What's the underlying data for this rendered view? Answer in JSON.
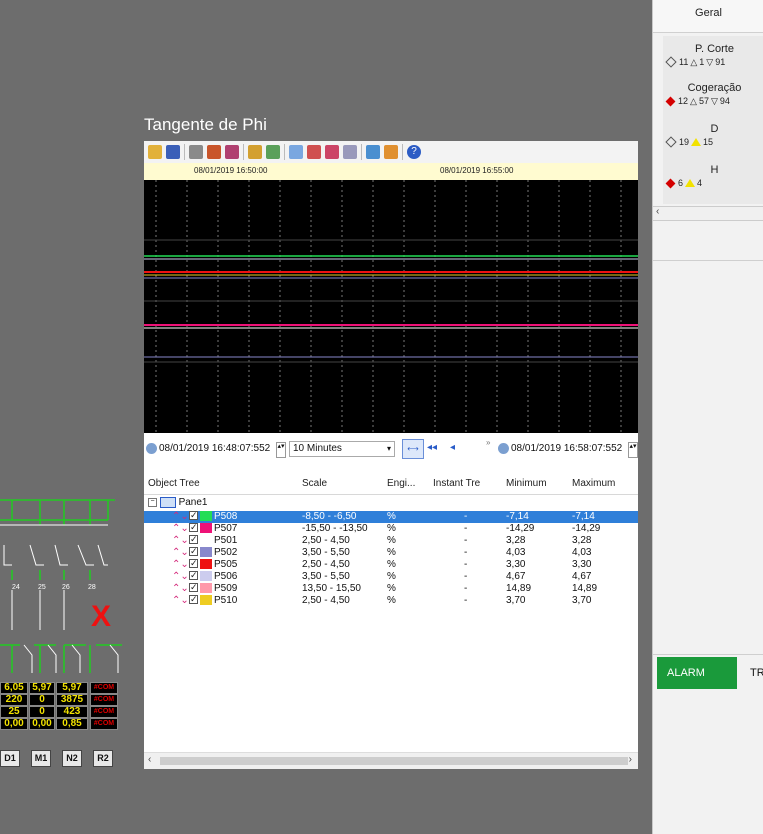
{
  "right_panel": {
    "tab_geral": "Geral",
    "zones": [
      {
        "name": "P. Corte",
        "c1": "11",
        "c2": "1",
        "c3": "91",
        "marker": "outline"
      },
      {
        "name": "Cogeração",
        "c1": "12",
        "c2": "57",
        "c3": "94",
        "marker": "red"
      },
      {
        "name": "D",
        "c1": "19",
        "c2": "15",
        "marker": "outline"
      },
      {
        "name": "H",
        "c1": "6",
        "c2": "4",
        "marker": "red"
      }
    ],
    "bottom_tabs": [
      "ALARM",
      "TR"
    ]
  },
  "window": {
    "title": "Tangente de Phi",
    "time_labels": [
      "08/01/2019 16:50:00",
      "08/01/2019 16:55:00"
    ],
    "start_time": "08/01/2019 16:48:07:552",
    "duration": "10 Minutes",
    "end_time": "08/01/2019 16:58:07:552",
    "columns": [
      "Object Tree",
      "Scale",
      "Engi...",
      "Instant Tre",
      "Minimum",
      "Maximum"
    ],
    "pane": "Pane1",
    "rows": [
      {
        "name": "P508",
        "scale": "-8,50 - -6,50",
        "eng": "%",
        "inst": "-",
        "min": "-7,14",
        "max": "-7,14",
        "color": "#22dd55",
        "selected": true
      },
      {
        "name": "P507",
        "scale": "-15,50 - -13,50",
        "eng": "%",
        "inst": "-",
        "min": "-14,29",
        "max": "-14,29",
        "color": "#ee1177"
      },
      {
        "name": "P501",
        "scale": "2,50 - 4,50",
        "eng": "%",
        "inst": "-",
        "min": "3,28",
        "max": "3,28",
        "color": "#ffffff"
      },
      {
        "name": "P502",
        "scale": "3,50 - 5,50",
        "eng": "%",
        "inst": "-",
        "min": "4,03",
        "max": "4,03",
        "color": "#8888cc"
      },
      {
        "name": "P505",
        "scale": "2,50 - 4,50",
        "eng": "%",
        "inst": "-",
        "min": "3,30",
        "max": "3,30",
        "color": "#ee1111"
      },
      {
        "name": "P506",
        "scale": "3,50 - 5,50",
        "eng": "%",
        "inst": "-",
        "min": "4,67",
        "max": "4,67",
        "color": "#ccccee"
      },
      {
        "name": "P509",
        "scale": "13,50 - 15,50",
        "eng": "%",
        "inst": "-",
        "min": "14,89",
        "max": "14,89",
        "color": "#ff99aa"
      },
      {
        "name": "P510",
        "scale": "2,50 - 4,50",
        "eng": "%",
        "inst": "-",
        "min": "3,70",
        "max": "3,70",
        "color": "#eecc22"
      }
    ]
  },
  "diagram": {
    "feeder_numbers": [
      "24",
      "25",
      "26",
      "28"
    ],
    "fault_mark": "X",
    "values": [
      [
        "6,05",
        "5,97",
        "5,97",
        "#COM"
      ],
      [
        "220",
        "0",
        "3875",
        "#COM"
      ],
      [
        "25",
        "0",
        "423",
        "#COM"
      ],
      [
        "0,00",
        "0,00",
        "0,85",
        "#COM"
      ]
    ],
    "labels": [
      "D1",
      "M1",
      "N2",
      "R2"
    ]
  }
}
